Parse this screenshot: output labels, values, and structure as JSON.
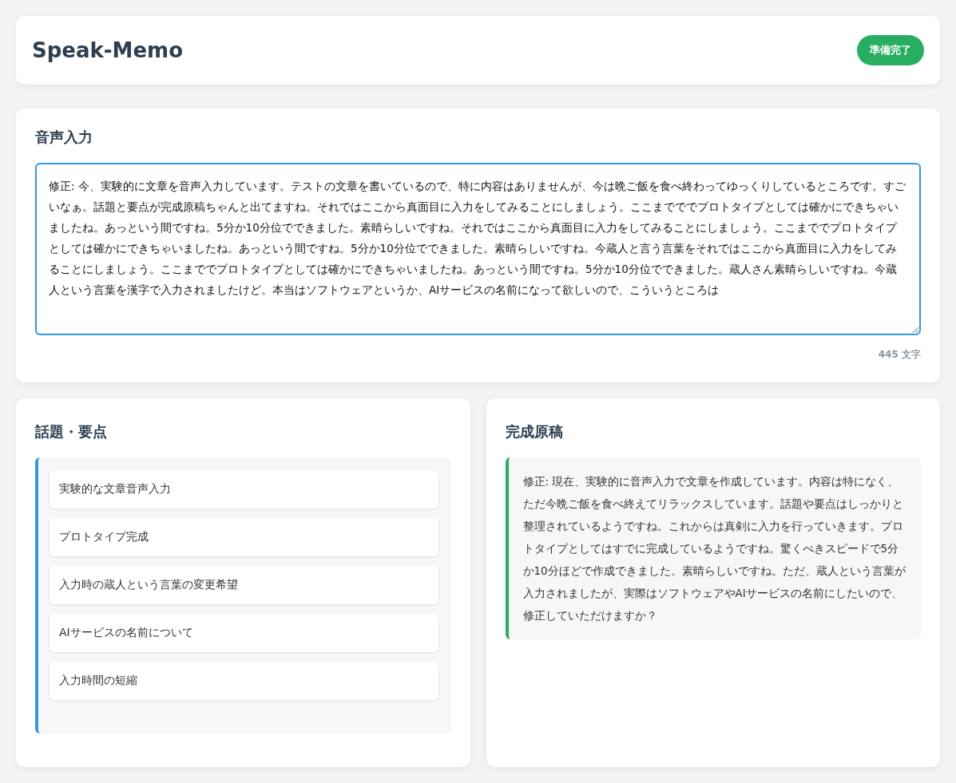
{
  "header": {
    "title": "Speak-Memo",
    "status": "準備完了"
  },
  "voice_input": {
    "heading": "音声入力",
    "value": "修正: 今、実験的に文章を音声入力しています。テストの文章を書いているので、特に内容はありませんが、今は晩ご飯を食べ終わってゆっくりしているところです。すごいなぁ。話題と要点が完成原稿ちゃんと出てますね。それではここから真面目に入力をしてみることにしましょう。ここまでででプロトタイプとしては確かにできちゃいましたね。あっという間ですね。5分か10分位でできました。素晴らしいですね。それではここから真面目に入力をしてみることにしましょう。ここまででプロトタイプとしては確かにできちゃいましたね。あっという間ですね。5分か10分位でできました。素晴らしいですね。今蔵人と言う言葉をそれではここから真面目に入力をしてみることにしましょう。ここまででプロトタイプとしては確かにできちゃいましたね。あっという間ですね。5分か10分位でできました。蔵人さん素晴らしいですね。今蔵人という言葉を漢字で入力されましたけど。本当はソフトウェアというか、AIサービスの名前になって欲しいので、こういうところは",
    "count": "445 文字"
  },
  "topics": {
    "heading": "話題・要点",
    "items": [
      "実験的な文章音声入力",
      "プロトタイプ完成",
      "入力時の蔵人という言葉の変更希望",
      "AIサービスの名前について",
      "入力時間の短縮"
    ]
  },
  "draft": {
    "heading": "完成原稿",
    "text": "修正: 現在、実験的に音声入力で文章を作成しています。内容は特になく、ただ今晩ご飯を食べ終えてリラックスしています。話題や要点はしっかりと整理されているようですね。これからは真剣に入力を行っていきます。プロトタイプとしてはすでに完成しているようですね。驚くべきスピードで5分か10分ほどで作成できました。素晴らしいですね。ただ、蔵人という言葉が入力されましたが、実際はソフトウェアやAIサービスの名前にしたいので、修正していただけますか？"
  }
}
